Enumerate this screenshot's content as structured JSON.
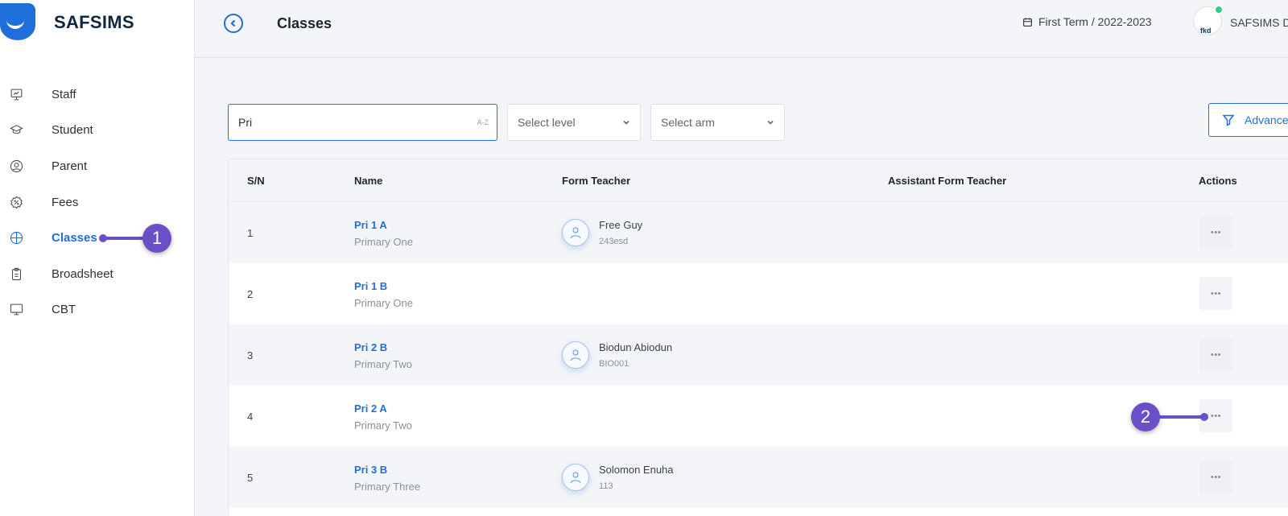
{
  "app": {
    "brand": "SAFSIMS"
  },
  "sidebar": {
    "items": [
      {
        "label": "Staff",
        "icon": "presentation-icon"
      },
      {
        "label": "Student",
        "icon": "graduation-cap-icon"
      },
      {
        "label": "Parent",
        "icon": "user-circle-icon"
      },
      {
        "label": "Fees",
        "icon": "badge-percent-icon"
      },
      {
        "label": "Classes",
        "icon": "grid-circle-icon",
        "active": true
      },
      {
        "label": "Broadsheet",
        "icon": "clipboard-icon"
      },
      {
        "label": "CBT",
        "icon": "monitor-icon"
      }
    ]
  },
  "header": {
    "title": "Classes",
    "term": "First Term / 2022-2023",
    "avatar_text": "fkd",
    "user_name": "SAFSIMS De"
  },
  "filters": {
    "search_value": "Pri",
    "search_sort_hint": "A-Z",
    "level_placeholder": "Select level",
    "arm_placeholder": "Select arm",
    "advanced_label": "Advance"
  },
  "table": {
    "headers": {
      "sn": "S/N",
      "name": "Name",
      "form_teacher": "Form Teacher",
      "assistant": "Assistant Form Teacher",
      "actions": "Actions"
    },
    "rows": [
      {
        "sn": "1",
        "name": "Pri 1 A",
        "level": "Primary One",
        "teacher": "Free Guy",
        "teacher_id": "243esd"
      },
      {
        "sn": "2",
        "name": "Pri 1 B",
        "level": "Primary One",
        "teacher": "",
        "teacher_id": ""
      },
      {
        "sn": "3",
        "name": "Pri 2 B",
        "level": "Primary Two",
        "teacher": "Biodun Abiodun",
        "teacher_id": "BIO001"
      },
      {
        "sn": "4",
        "name": "Pri 2 A",
        "level": "Primary Two",
        "teacher": "",
        "teacher_id": ""
      },
      {
        "sn": "5",
        "name": "Pri 3 B",
        "level": "Primary Three",
        "teacher": "Solomon Enuha",
        "teacher_id": "113"
      }
    ],
    "action_label": "•••"
  },
  "callouts": {
    "one": "1",
    "two": "2"
  },
  "colors": {
    "accent": "#1e6fd9",
    "callout": "#6b4fc6",
    "online": "#2ecc8f"
  }
}
